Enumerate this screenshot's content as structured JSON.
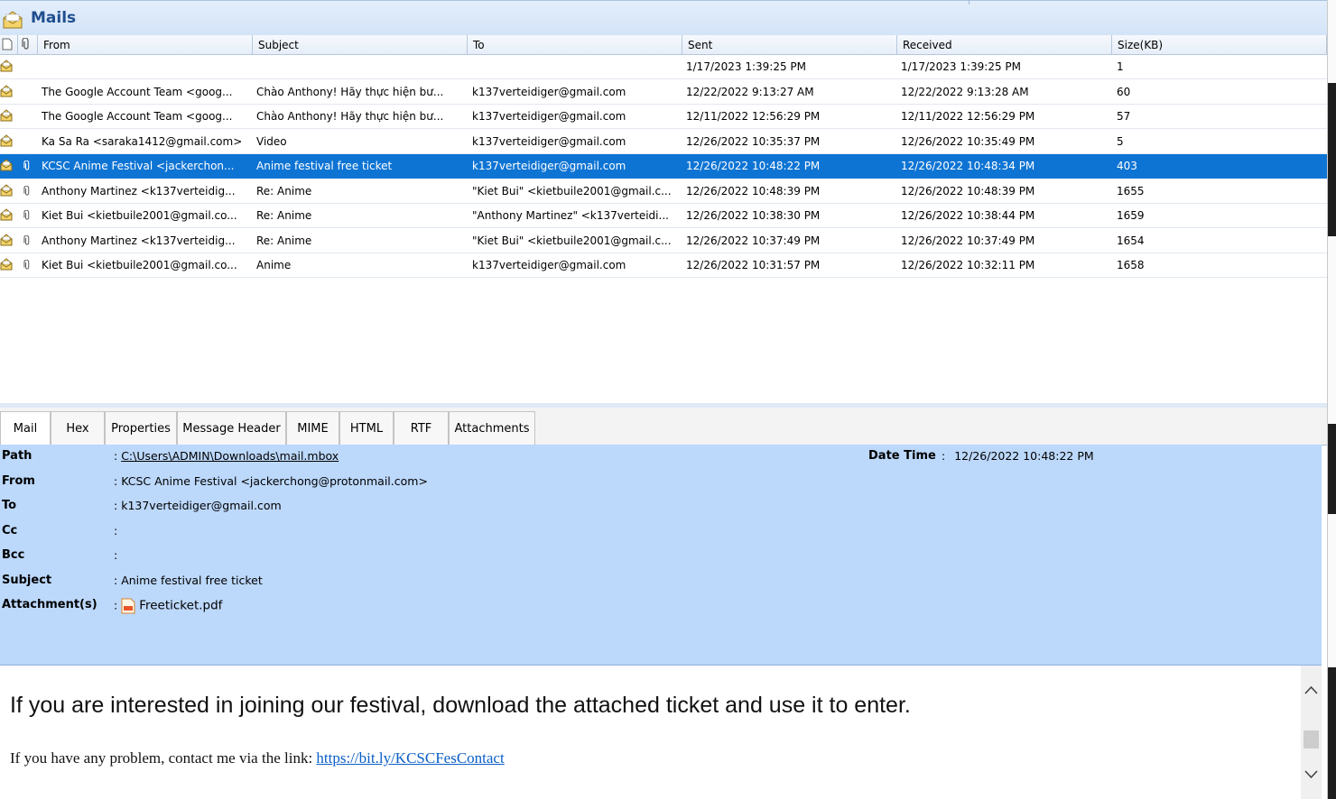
{
  "window": {
    "title": "Mails"
  },
  "columns": {
    "from": "From",
    "subject": "Subject",
    "to": "To",
    "sent": "Sent",
    "received": "Received",
    "size": "Size(KB)"
  },
  "mails": [
    {
      "from": "",
      "subject": "",
      "to": "",
      "sent": "1/17/2023 1:39:25 PM",
      "received": "1/17/2023 1:39:25 PM",
      "size": "1",
      "attachment": false,
      "selected": false
    },
    {
      "from": "The Google Account Team <goog...",
      "subject": "Chào Anthony! Hãy thực hiện bư...",
      "to": "k137verteidiger@gmail.com",
      "sent": "12/22/2022 9:13:27 AM",
      "received": "12/22/2022 9:13:28 AM",
      "size": "60",
      "attachment": false,
      "selected": false
    },
    {
      "from": "The Google Account Team <goog...",
      "subject": "Chào Anthony! Hãy thực hiện bư...",
      "to": "k137verteidiger@gmail.com",
      "sent": "12/11/2022 12:56:29 PM",
      "received": "12/11/2022 12:56:29 PM",
      "size": "57",
      "attachment": false,
      "selected": false
    },
    {
      "from": "Ka Sa Ra <saraka1412@gmail.com>",
      "subject": "Video",
      "to": "k137verteidiger@gmail.com",
      "sent": "12/26/2022 10:35:37 PM",
      "received": "12/26/2022 10:35:49 PM",
      "size": "5",
      "attachment": false,
      "selected": false
    },
    {
      "from": "KCSC Anime Festival <jackerchon...",
      "subject": "Anime festival free ticket",
      "to": "k137verteidiger@gmail.com",
      "sent": "12/26/2022 10:48:22 PM",
      "received": "12/26/2022 10:48:34 PM",
      "size": "403",
      "attachment": true,
      "selected": true
    },
    {
      "from": "Anthony Martinez <k137verteidig...",
      "subject": "Re: Anime",
      "to": "\"Kiet Bui\" <kietbuile2001@gmail.c...",
      "sent": "12/26/2022 10:48:39 PM",
      "received": "12/26/2022 10:48:39 PM",
      "size": "1655",
      "attachment": true,
      "selected": false
    },
    {
      "from": "Kiet Bui <kietbuile2001@gmail.co...",
      "subject": "Re: Anime",
      "to": "\"Anthony Martinez\" <k137verteidi...",
      "sent": "12/26/2022 10:38:30 PM",
      "received": "12/26/2022 10:38:44 PM",
      "size": "1659",
      "attachment": true,
      "selected": false
    },
    {
      "from": "Anthony Martinez <k137verteidig...",
      "subject": "Re: Anime",
      "to": "\"Kiet Bui\" <kietbuile2001@gmail.c...",
      "sent": "12/26/2022 10:37:49 PM",
      "received": "12/26/2022 10:37:49 PM",
      "size": "1654",
      "attachment": true,
      "selected": false
    },
    {
      "from": "Kiet Bui <kietbuile2001@gmail.co...",
      "subject": "Anime",
      "to": "k137verteidiger@gmail.com",
      "sent": "12/26/2022 10:31:57 PM",
      "received": "12/26/2022 10:32:11 PM",
      "size": "1658",
      "attachment": true,
      "selected": false
    }
  ],
  "tabs": [
    "Mail",
    "Hex",
    "Properties",
    "Message Header",
    "MIME",
    "HTML",
    "RTF",
    "Attachments"
  ],
  "details": {
    "path_label": "Path",
    "path_value": "C:\\Users\\ADMIN\\Downloads\\mail.mbox",
    "datetime_label": "Date Time",
    "datetime_value": "12/26/2022 10:48:22 PM",
    "from_label": "From",
    "from_value": "KCSC Anime Festival <jackerchong@protonmail.com>",
    "to_label": "To",
    "to_value": "k137verteidiger@gmail.com",
    "cc_label": "Cc",
    "cc_value": "",
    "bcc_label": "Bcc",
    "bcc_value": "",
    "subject_label": "Subject",
    "subject_value": "Anime festival free ticket",
    "attachments_label": "Attachment(s)",
    "attachment_file": "Freeticket.pdf",
    "separator": ":"
  },
  "body": {
    "line1": "If you are interested in joining our festival, download the attached ticket and use it to enter.",
    "line2_prefix": "If you have any problem, contact me via the link: ",
    "link": "https://bit.ly/KCSCFesContact"
  },
  "colors": {
    "selection": "#0e74d4",
    "info_panel": "#bcd8fb",
    "title_text": "#1f4e8f",
    "link": "#0b5fc6"
  }
}
